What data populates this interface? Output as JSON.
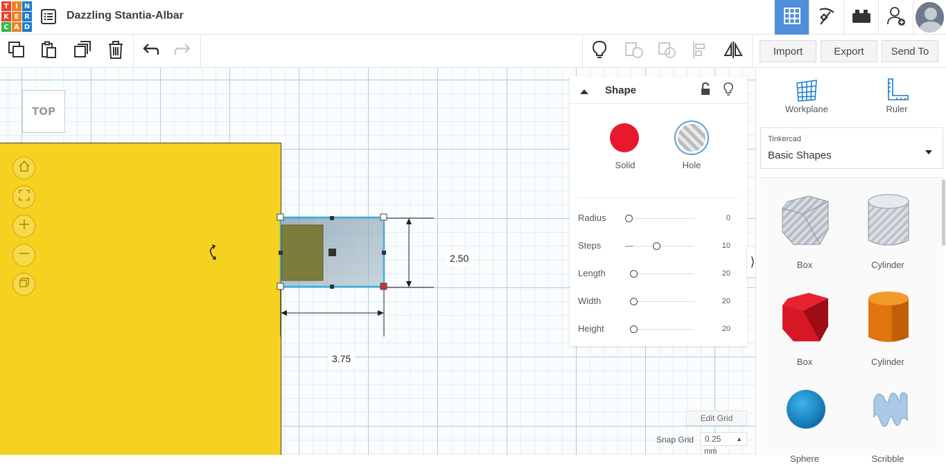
{
  "app": {
    "logo_letters": [
      "T",
      "I",
      "N",
      "K",
      "E",
      "R",
      "C",
      "A",
      "D"
    ],
    "logo_colors": [
      "#e8412c",
      "#f27f22",
      "#1a7bcd",
      "#e8412c",
      "#f27f22",
      "#1a7bcd",
      "#3cb44b",
      "#f27f22",
      "#1a7bcd"
    ],
    "title": "Dazzling Stantia-Albar"
  },
  "header_tools": [
    {
      "name": "3d-design-view-button",
      "icon": "grid-icon",
      "active": true
    },
    {
      "name": "codeblocks-button",
      "icon": "pickaxe-icon",
      "active": false
    },
    {
      "name": "bricks-button",
      "icon": "brick-icon",
      "active": false
    },
    {
      "name": "add-user-button",
      "icon": "user-plus-icon",
      "active": false
    }
  ],
  "toolbar": {
    "import_label": "Import",
    "export_label": "Export",
    "send_to_label": "Send To"
  },
  "viewcube": {
    "label": "TOP"
  },
  "dimensions": {
    "height": "2.50",
    "width": "3.75"
  },
  "shape_panel": {
    "title": "Shape",
    "solid_label": "Solid",
    "hole_label": "Hole",
    "solid_color": "#e8192c",
    "properties": [
      {
        "label": "Radius",
        "value": "0",
        "fraction": 0.0
      },
      {
        "label": "Steps",
        "value": "10",
        "fraction": 0.45
      },
      {
        "label": "Length",
        "value": "20",
        "fraction": 0.08
      },
      {
        "label": "Width",
        "value": "20",
        "fraction": 0.08
      },
      {
        "label": "Height",
        "value": "20",
        "fraction": 0.08
      }
    ]
  },
  "grid_controls": {
    "edit_grid_label": "Edit Grid",
    "snap_grid_label": "Snap Grid",
    "snap_value": "0.25",
    "snap_unit": "mm"
  },
  "sidebar": {
    "workplane_label": "Workplane",
    "ruler_label": "Ruler",
    "library_group": "Tinkercad",
    "library_name": "Basic Shapes",
    "shapes": [
      {
        "label": "Box",
        "kind": "box-hole"
      },
      {
        "label": "Cylinder",
        "kind": "cylinder-hole"
      },
      {
        "label": "Box",
        "kind": "box-red"
      },
      {
        "label": "Cylinder",
        "kind": "cylinder-orange"
      },
      {
        "label": "Sphere",
        "kind": "sphere-blue"
      },
      {
        "label": "Scribble",
        "kind": "scribble"
      }
    ]
  },
  "colors": {
    "accent": "#4d8fd9",
    "workplane_object": "#f5d21f",
    "selection": "#3fb0d9"
  }
}
